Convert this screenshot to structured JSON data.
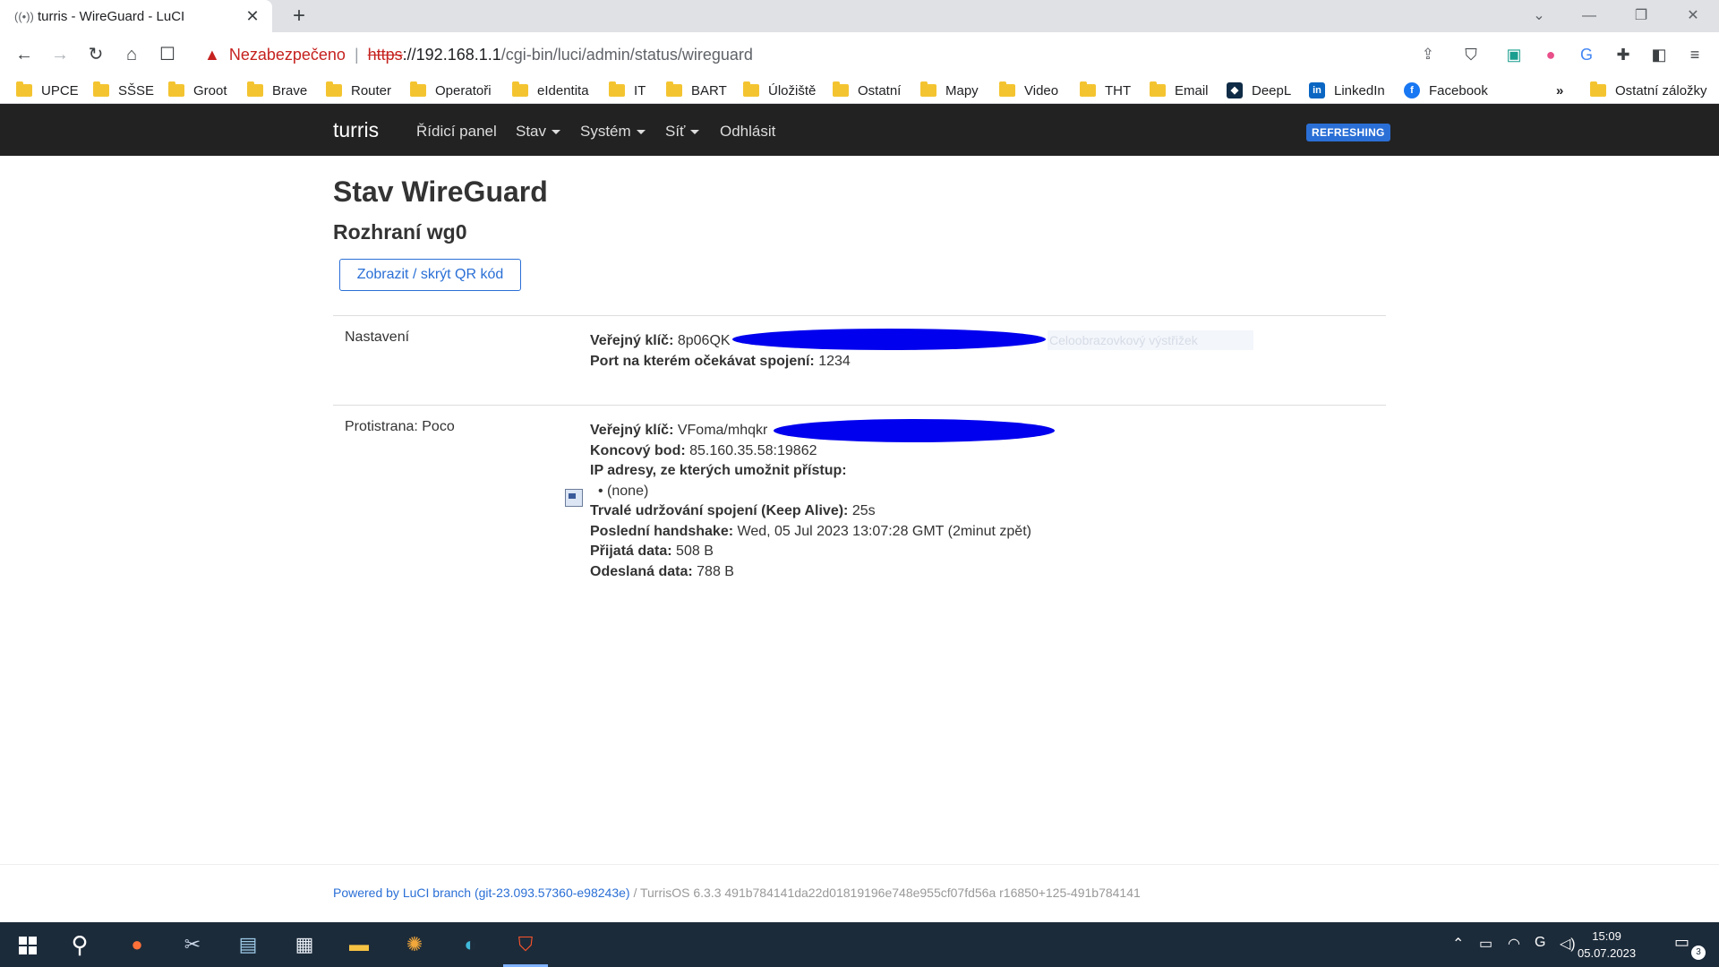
{
  "browser": {
    "tab_title": "turris - WireGuard - LuCI",
    "tab_icon": "wifi-signal-icon",
    "security_label": "Nezabezpečeno",
    "url_scheme": "https",
    "url_host": "://192.168.1.1",
    "url_path": "/cgi-bin/luci/admin/status/wireguard",
    "bookmarks": [
      "UPCE",
      "SŠSE",
      "Groot",
      "Brave",
      "Router",
      "Operatoři",
      "eIdentita",
      "IT",
      "BART",
      "Úložiště",
      "Ostatní",
      "Mapy",
      "Video",
      "THT",
      "Email",
      "DeepL",
      "LinkedIn",
      "Facebook"
    ],
    "bookmarks_more": "»",
    "other_bookmarks": "Ostatní záložky"
  },
  "luci": {
    "brand": "turris",
    "menu": [
      "Řídicí panel",
      "Stav",
      "Systém",
      "Síť",
      "Odhlásit"
    ],
    "status_badge": "REFRESHING",
    "page_title": "Stav WireGuard",
    "interface_title": "Rozhraní wg0",
    "qr_button": "Zobrazit / skrýt QR kód",
    "settings": {
      "label": "Nastavení",
      "public_key_label": "Veřejný klíč:",
      "public_key_value": "8p06QK",
      "port_label": "Port na kterém očekávat spojení:",
      "port_value": "1234",
      "overlay_text": "Celoobrazovkový výstřižek"
    },
    "peer": {
      "label": "Protistrana: Poco",
      "public_key_label": "Veřejný klíč:",
      "public_key_value": "VFoma/mhqkr",
      "endpoint_label": "Koncový bod:",
      "endpoint_value": "85.160.35.58:19862",
      "allowed_ips_label": "IP adresy, ze kterých umožnit přístup:",
      "allowed_ips_value": "• (none)",
      "keepalive_label": "Trvalé udržování spojení (Keep Alive):",
      "keepalive_value": "25s",
      "handshake_label": "Poslední handshake:",
      "handshake_value": "Wed, 05 Jul 2023 13:07:28 GMT (2minut zpět)",
      "rx_label": "Přijatá data:",
      "rx_value": "508 B",
      "tx_label": "Odeslaná data:",
      "tx_value": "788 B"
    },
    "footer_link": "Powered by LuCI branch (git-23.093.57360-e98243e)",
    "footer_rest": " / TurrisOS 6.3.3 491b784141da22d01819196e748e955cf07fd56a r16850+125-491b784141"
  },
  "taskbar": {
    "time": "15:09",
    "date": "05.07.2023",
    "notifications": "3"
  },
  "colors": {
    "header_bg": "#222222",
    "accent": "#2a6fd6",
    "insecure": "#c5221f",
    "redaction": "#0000ee",
    "taskbar": "#1c2b3a"
  }
}
